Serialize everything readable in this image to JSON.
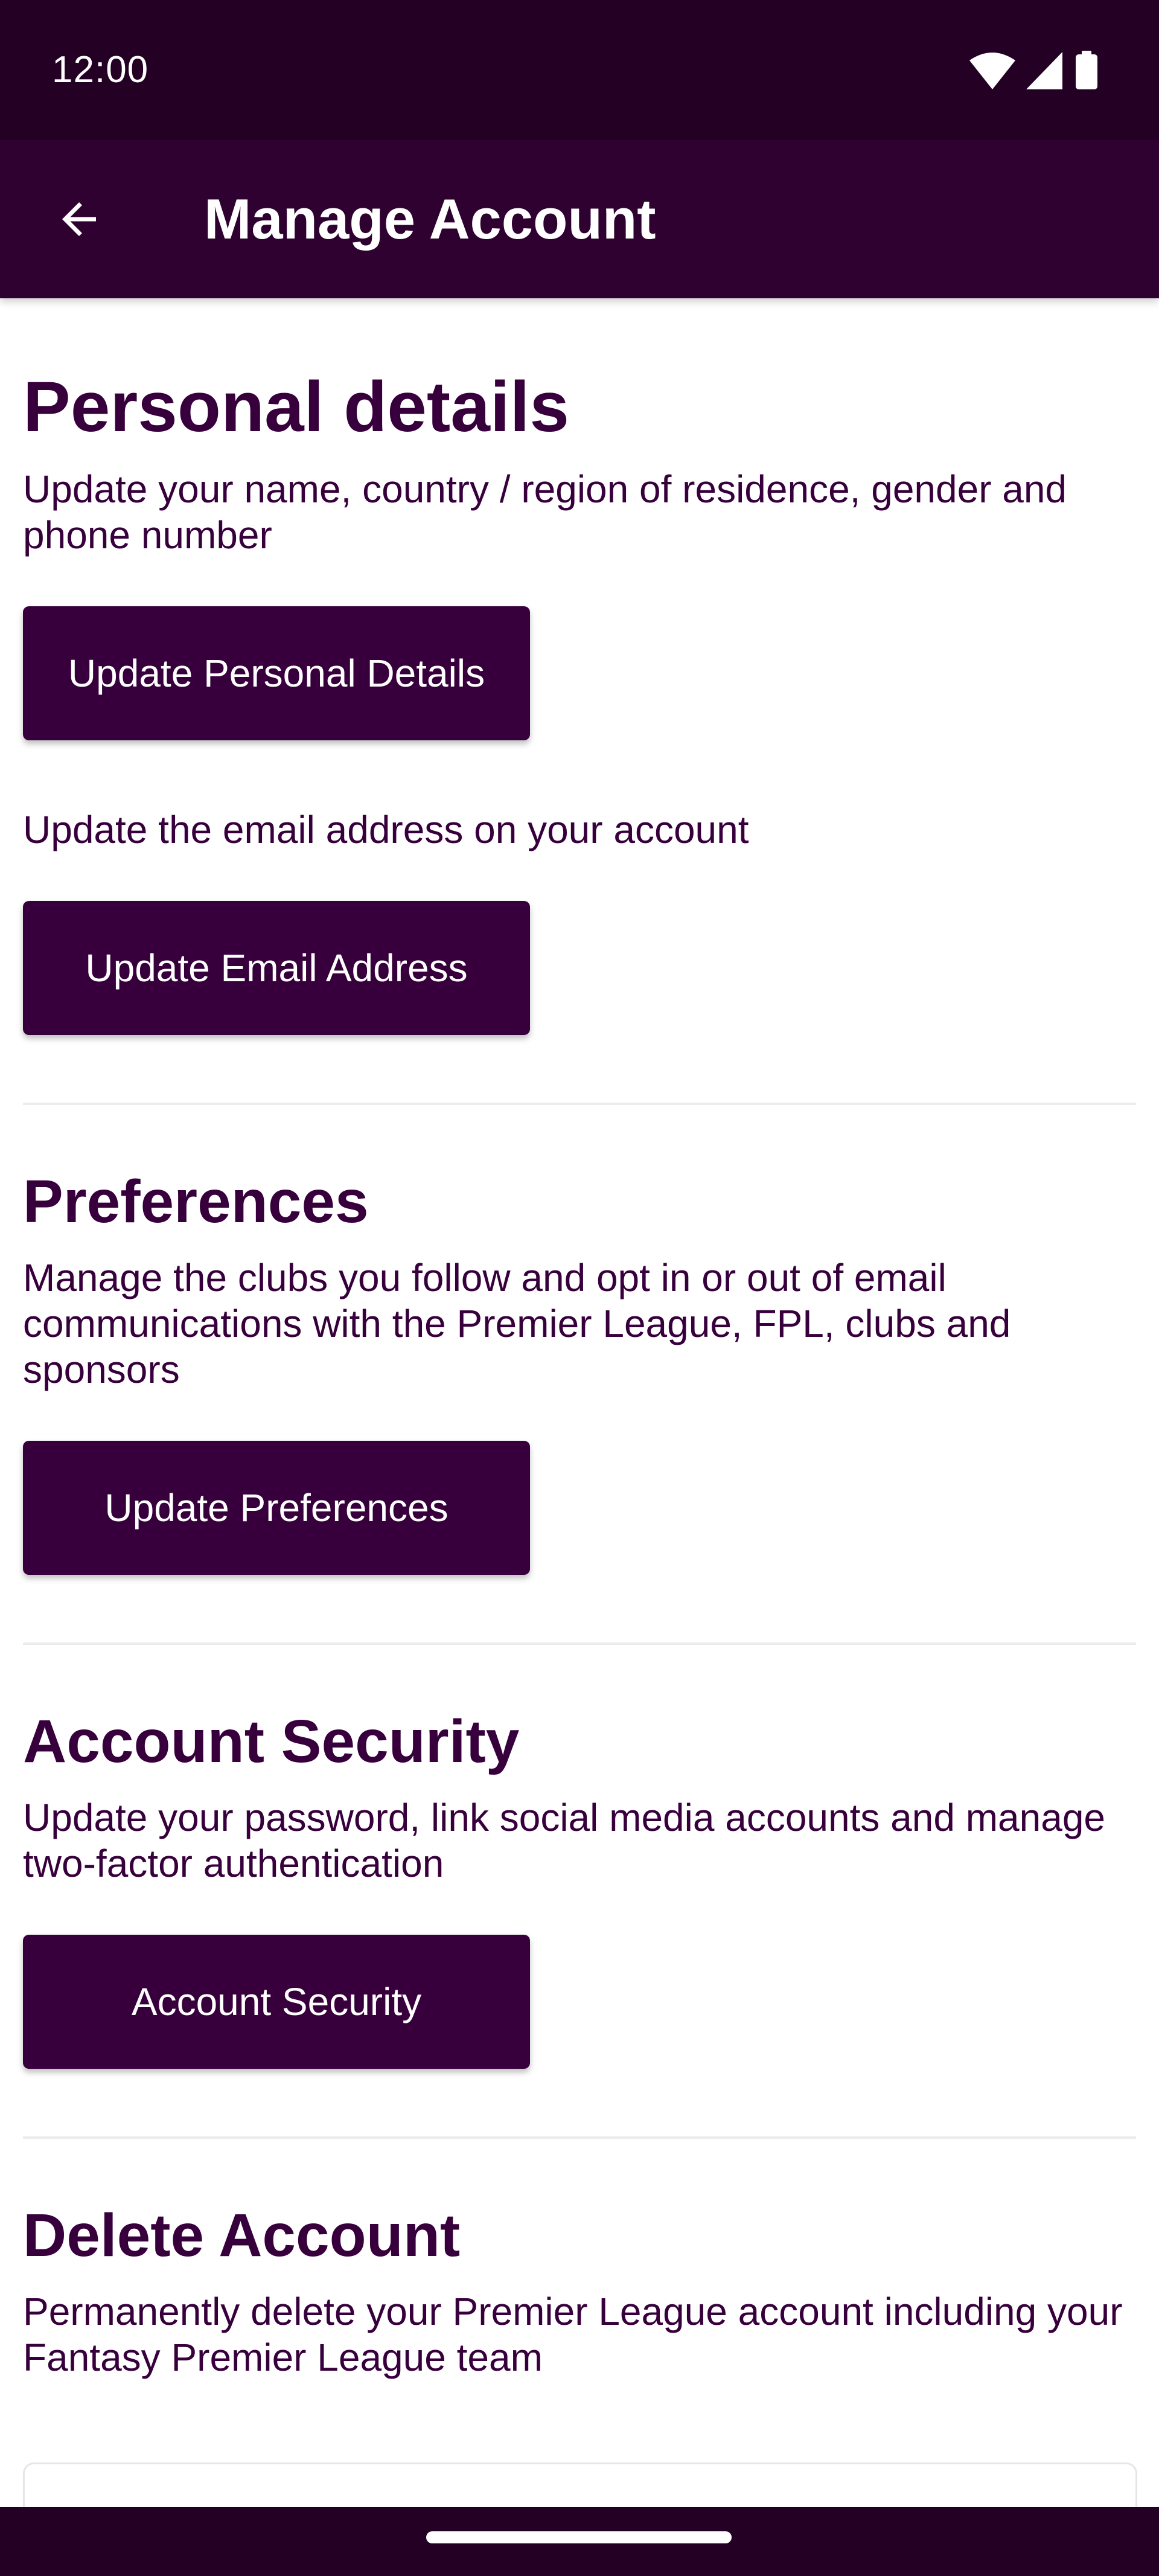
{
  "status_bar": {
    "time": "12:00",
    "icons": [
      "wifi-icon",
      "cell-signal-icon",
      "battery-icon"
    ]
  },
  "app_bar": {
    "title": "Manage Account",
    "back_icon": "arrow-left-icon"
  },
  "sections": {
    "personal": {
      "heading": "Personal details",
      "description": "Update your name, country / region of residence, gender and phone number",
      "button_label": "Update Personal Details",
      "email_description": "Update the email address on your account",
      "email_button_label": "Update Email Address"
    },
    "preferences": {
      "heading": "Preferences",
      "description": "Manage the clubs you follow and opt in or out of email communications with the Premier League, FPL, clubs and sponsors",
      "button_label": "Update Preferences"
    },
    "security": {
      "heading": "Account Security",
      "description": "Update your password, link social media accounts and manage two-factor authentication",
      "button_label": "Account Security"
    },
    "delete": {
      "heading": "Delete Account",
      "description": "Permanently delete your Premier League account including your Fantasy Premier League team"
    }
  },
  "colors": {
    "brand_purple": "#37003c",
    "app_bar": "#2f0131",
    "status_bar": "#230024",
    "background": "#ffffff",
    "divider": "#ececec"
  }
}
